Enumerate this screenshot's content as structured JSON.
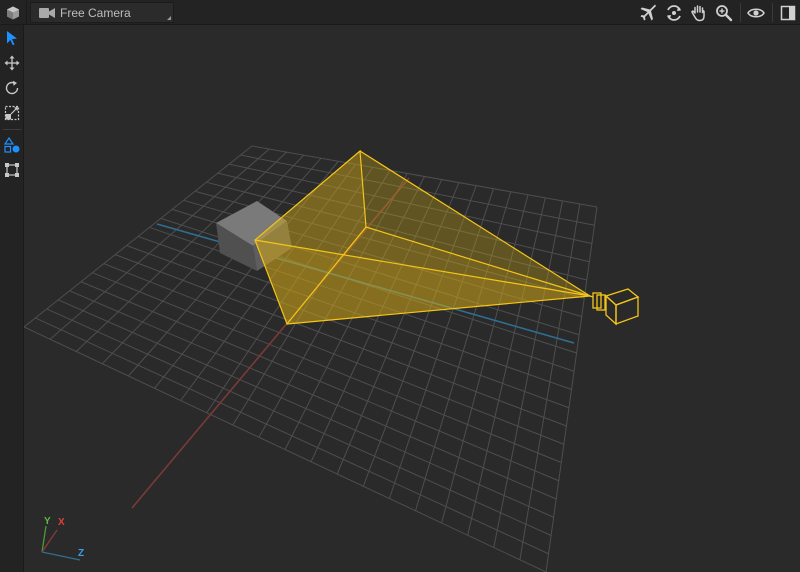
{
  "topbar": {
    "camera_select": {
      "selected": "Free Camera"
    },
    "icons": {
      "logo": "cube-logo-icon",
      "camera": "video-camera-icon",
      "fly": "airplane-fly-icon",
      "orbit": "orbit-rotate-icon",
      "pan": "hand-pan-icon",
      "zoom": "zoom-magnifier-icon",
      "visibility": "eye-visibility-icon",
      "panel": "panel-toggle-icon"
    }
  },
  "left_toolbar": {
    "tools": [
      {
        "name": "select-tool",
        "icon": "cursor-arrow-icon",
        "active": true
      },
      {
        "name": "move-tool",
        "icon": "move-arrows-icon",
        "active": false
      },
      {
        "name": "rotate-tool",
        "icon": "rotate-icon",
        "active": false
      },
      {
        "name": "scale-tool",
        "icon": "scale-icon",
        "active": false
      },
      {
        "name": "create-shapes-tool",
        "icon": "shapes-icon",
        "active": false
      },
      {
        "name": "bounds-tool",
        "icon": "bounding-box-icon",
        "active": false
      }
    ]
  },
  "viewport": {
    "axis_gizmo": {
      "y_label": "Y",
      "x_label": "X",
      "z_label": "Z"
    },
    "colors": {
      "background": "#2a2a2a",
      "grid": "#4e4e4e",
      "x_axis": "#7a3a38",
      "z_axis": "#2f6f93",
      "frustum": "#f5c518",
      "cube": "#5c5c5c",
      "accent": "#1e90ff"
    }
  }
}
